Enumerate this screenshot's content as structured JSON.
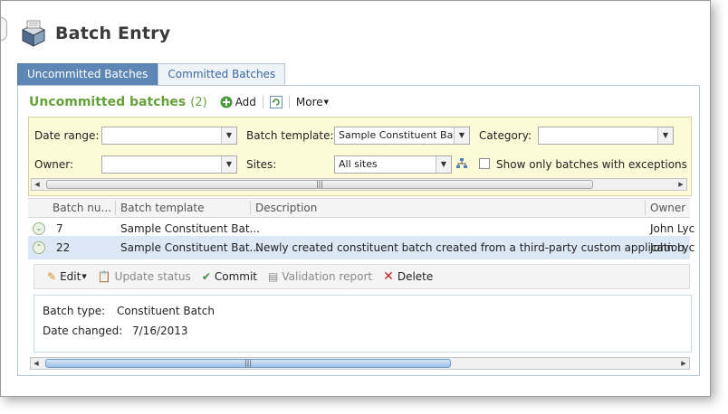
{
  "page": {
    "title": "Batch Entry",
    "title_icon": "batch-entry-icon"
  },
  "tabs": [
    {
      "label": "Uncommitted Batches",
      "active": true
    },
    {
      "label": "Committed Batches",
      "active": false
    }
  ],
  "section": {
    "title": "Uncommitted batches",
    "count": "(2)",
    "add_label": "Add",
    "more_label": "More"
  },
  "filters": {
    "date_range": {
      "label": "Date range:",
      "value": ""
    },
    "batch_template": {
      "label": "Batch template:",
      "value": "Sample Constituent Batch"
    },
    "category": {
      "label": "Category:",
      "value": ""
    },
    "owner": {
      "label": "Owner:",
      "value": ""
    },
    "sites": {
      "label": "Sites:",
      "value": "All sites"
    },
    "exceptions": {
      "label": "Show only batches with exceptions",
      "checked": false
    }
  },
  "grid": {
    "columns": [
      "Batch nu...",
      "Batch template",
      "Description",
      "Owner"
    ],
    "rows": [
      {
        "number": "7",
        "template": "Sample Constituent Bat...",
        "description": "",
        "owner": "John Lyc"
      },
      {
        "number": "22",
        "template": "Sample Constituent Bat...",
        "description": "Newly created constituent batch created from a third-party custom application.",
        "owner": "John Lyc"
      }
    ]
  },
  "detail_toolbar": {
    "edit": "Edit",
    "update_status": "Update status",
    "commit": "Commit",
    "validation_report": "Validation report",
    "delete": "Delete"
  },
  "detail": {
    "batch_type_label": "Batch type:",
    "batch_type_value": "Constituent Batch",
    "date_changed_label": "Date changed:",
    "date_changed_value": "7/16/2013"
  },
  "colors": {
    "active_tab": "#5f87b6",
    "section_title": "#66a13a",
    "filter_bg": "#fdfbd7",
    "selected_row": "#dce8f6",
    "delete_icon": "#cc2222"
  }
}
